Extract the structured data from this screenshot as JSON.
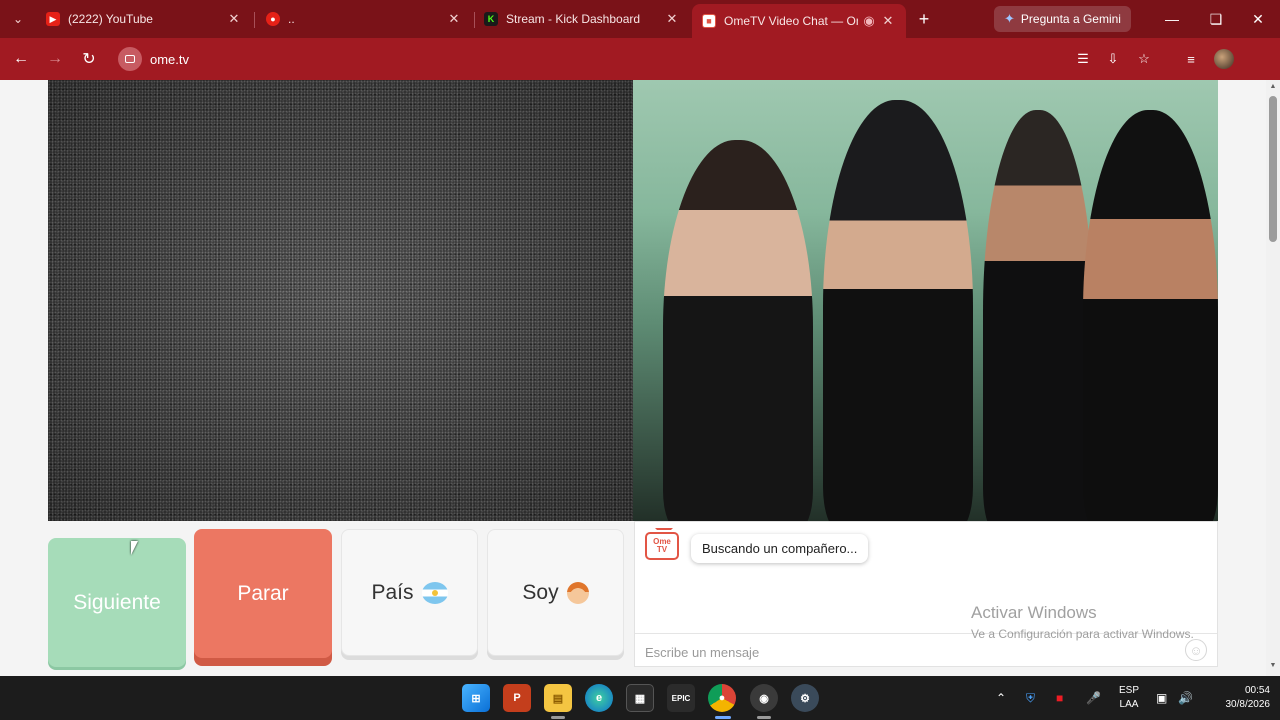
{
  "browser": {
    "tabs": [
      {
        "title": "(2222) YouTube",
        "favicon": "youtube-icon",
        "color": "#e62117"
      },
      {
        "title": "..",
        "favicon": "youtube-music-icon",
        "color": "#e62117"
      },
      {
        "title": "Stream - Kick Dashboard",
        "favicon": "kick-icon",
        "color": "#53fc18"
      },
      {
        "title": "OmeTV Video Chat — Omegle",
        "favicon": "ometv-icon",
        "color": "#e25545"
      }
    ],
    "gemini_label": "Pregunta a Gemini",
    "url": "ome.tv"
  },
  "page": {
    "controls": {
      "next": "Siguiente",
      "stop": "Parar",
      "country": "País",
      "gender": "Soy"
    },
    "chat": {
      "logo_text_1": "Ome",
      "logo_text_2": "TV",
      "status": "Buscando un compañero...",
      "placeholder": "Escribe un mensaje"
    },
    "watermark": {
      "title": "Activar Windows",
      "subtitle": "Ve a Configuración para activar Windows."
    }
  },
  "taskbar": {
    "lang_1": "ESP",
    "lang_2": "LAA",
    "time": "00:54",
    "date": "30/8/2026"
  },
  "colors": {
    "browser_frame": "#7a1218",
    "toolbar": "#a11a22",
    "next_button": "#a6dcb9",
    "stop_button": "#ec7762"
  }
}
